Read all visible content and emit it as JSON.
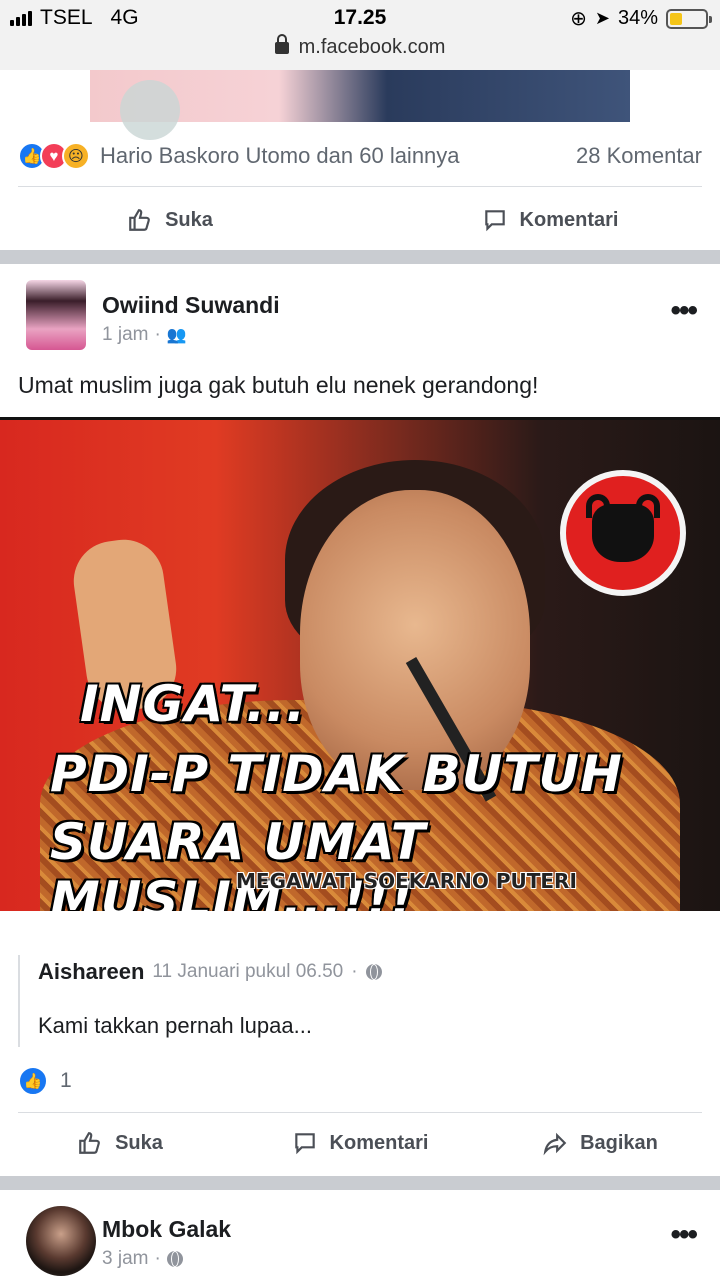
{
  "status_bar": {
    "carrier": "TSEL",
    "network": "4G",
    "time": "17.25",
    "battery": "34%",
    "battery_level": 0.34
  },
  "browser": {
    "url": "m.facebook.com"
  },
  "previous_post": {
    "reactions_text": "Hario Baskoro Utomo dan 60 lainnya",
    "comments_text": "28 Komentar",
    "reaction_types": [
      "like",
      "love",
      "sad"
    ],
    "actions": {
      "like": "Suka",
      "comment": "Komentari"
    }
  },
  "post": {
    "author": "Owiind Suwandi",
    "time": "1 jam",
    "audience_icon": "friends-icon",
    "text": "Umat muslim juga gak butuh elu nenek gerandong!",
    "image_text": {
      "line1": "INGAT...",
      "line2": "PDI-P TIDAK BUTUH",
      "line3": "SUARA UMAT MUSLIM...!!!",
      "credit": "MEGAWATI SOEKARNO PUTERI"
    },
    "shared": {
      "author": "Aishareen",
      "time": "11 Januari pukul 06.50",
      "audience_icon": "globe-icon",
      "text": "Kami takkan pernah lupaa..."
    },
    "like_count": "1",
    "actions": {
      "like": "Suka",
      "comment": "Komentari",
      "share": "Bagikan"
    }
  },
  "next_post": {
    "author": "Mbok Galak",
    "time": "3 jam",
    "audience_icon": "globe-icon"
  },
  "colors": {
    "facebook_blue": "#1877f2",
    "love_red": "#f33e58",
    "sad_yellow": "#f7b125",
    "separator": "#c9ccd1"
  }
}
